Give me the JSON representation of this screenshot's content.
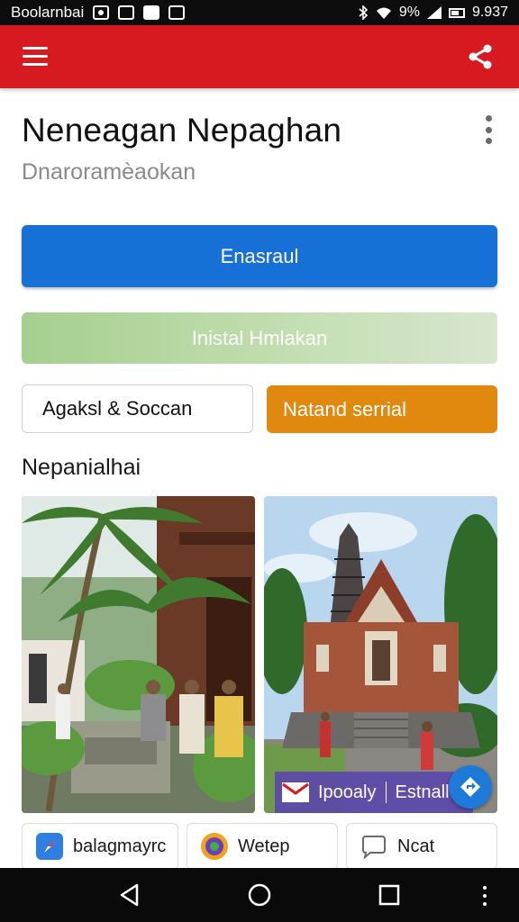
{
  "status_bar": {
    "carrier": "Boolarnbai",
    "battery": "9%",
    "time": "9.937",
    "icons": [
      "camera-icon",
      "image-icon",
      "mail-icon",
      "record-icon",
      "bluetooth-icon",
      "wifi-icon",
      "signal-icon",
      "battery-icon"
    ]
  },
  "app_bar": {
    "color": "#d71920",
    "menu_icon": "menu-icon",
    "share_icon": "share-icon"
  },
  "header": {
    "title": "Neneagan Nepaghan",
    "subtitle": "Dnaroramèaokan"
  },
  "actions": {
    "primary_label": "Enasraul",
    "secondary_label": "Inistal Hmlakan",
    "outline_label": "Agaksl & Soccan",
    "orange_label": "Natand serrial"
  },
  "section": {
    "title": "Nepanialhai"
  },
  "gallery": {
    "overlay_left": "Ipooaly",
    "overlay_right": "Estnall"
  },
  "chips": [
    {
      "label": "balagmayrc",
      "icon": "compass-icon"
    },
    {
      "label": "Wetep",
      "icon": "app-logo-icon"
    },
    {
      "label": "Ncat",
      "icon": "chat-icon"
    }
  ],
  "colors": {
    "accent": "#d71920",
    "primary_button": "#1770d6",
    "secondary_button": "#a5cf8f",
    "orange_button": "#e0890e",
    "overlay": "#5c48aa"
  }
}
